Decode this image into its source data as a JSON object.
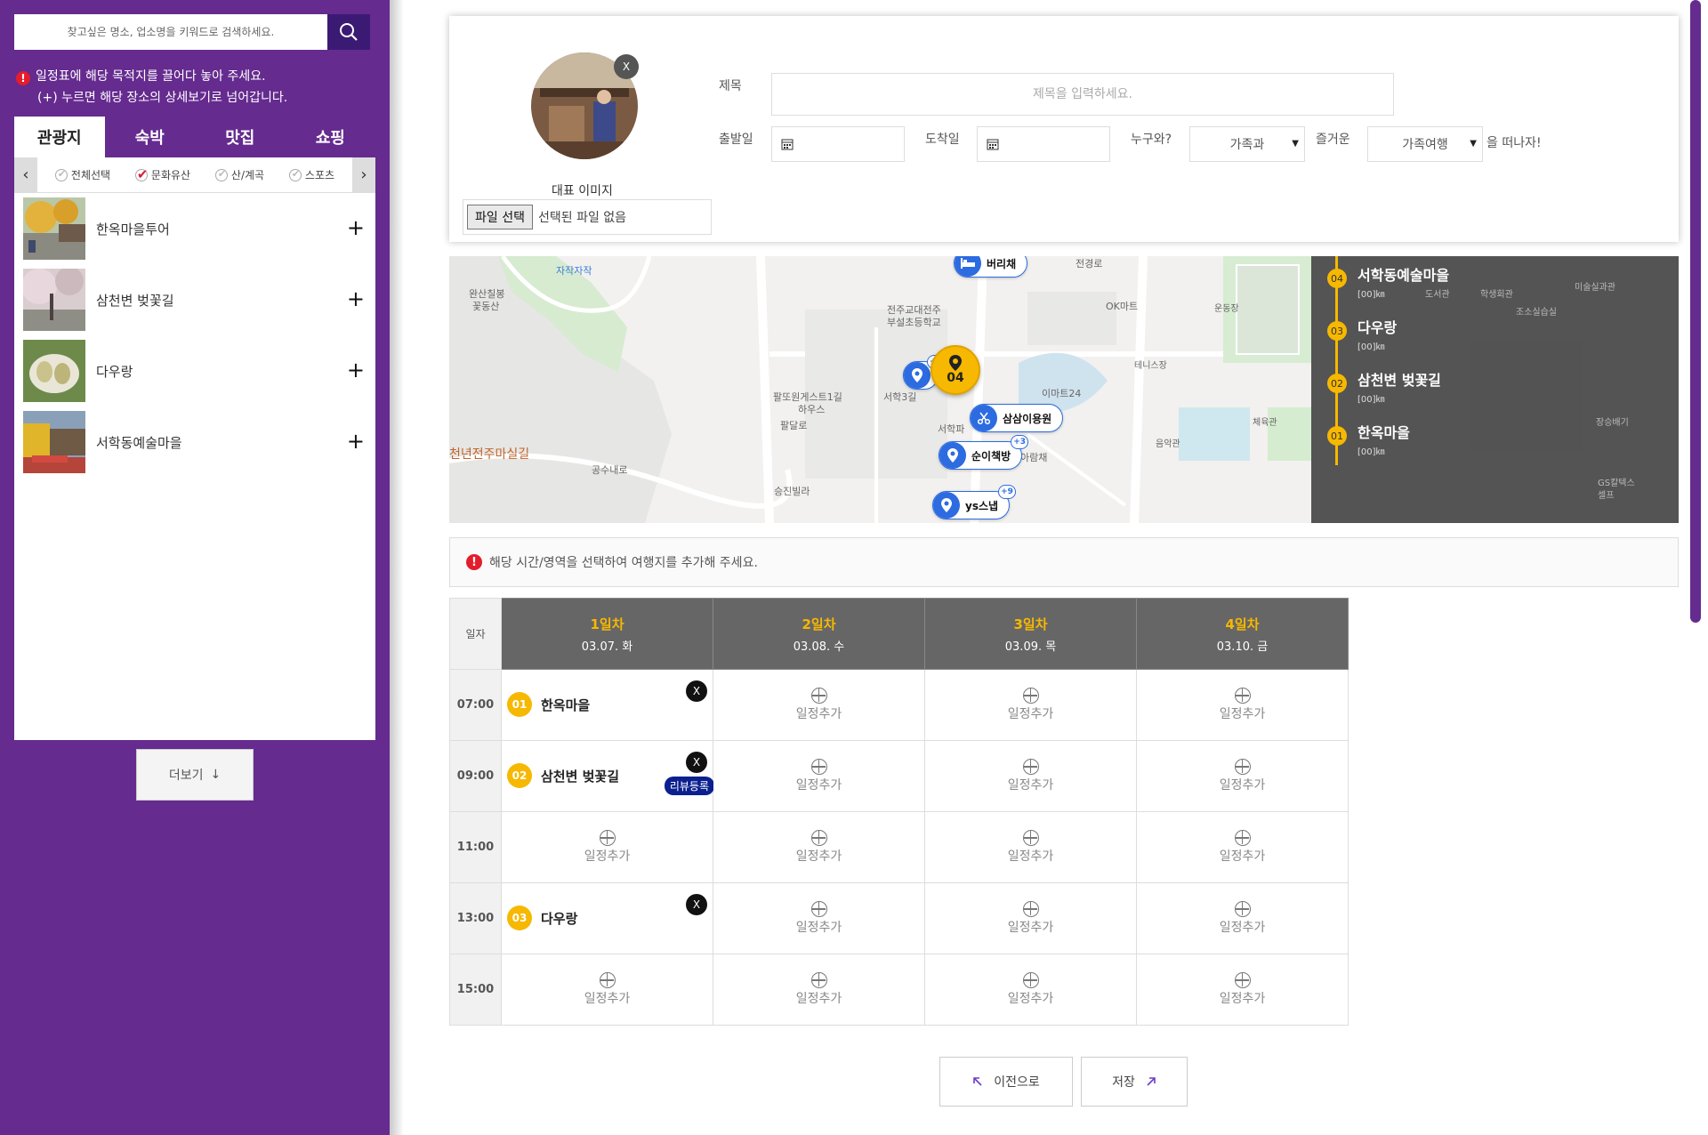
{
  "sidebar": {
    "search_placeholder": "찾고싶은 명소, 업소명을 키워드로 검색하세요.",
    "notice_line1": "일정표에 해당 목적지를 끌어다 놓아 주세요.",
    "notice_line2": "(+) 누르면 해당 장소의 상세보기로 넘어갑니다.",
    "tabs": [
      {
        "label": "관광지"
      },
      {
        "label": "숙박"
      },
      {
        "label": "맛집"
      },
      {
        "label": "쇼핑"
      }
    ],
    "filters": [
      {
        "label": "전체선택",
        "checked": false
      },
      {
        "label": "문화유산",
        "checked": true
      },
      {
        "label": "산/계곡",
        "checked": false
      },
      {
        "label": "스포츠",
        "checked": false
      }
    ],
    "places": [
      {
        "name": "한옥마을투어"
      },
      {
        "name": "삼천변 벚꽃길"
      },
      {
        "name": "다우랑"
      },
      {
        "name": "서학동예술마을"
      }
    ],
    "more_label": "더보기"
  },
  "form": {
    "rep_image_label": "대표 이미지",
    "file_button": "파일 선택",
    "file_status": "선택된 파일 없음",
    "close_label": "X",
    "title_label": "제목",
    "title_placeholder": "제목을 입력하세요.",
    "depart_label": "출발일",
    "arrive_label": "도착일",
    "who_label": "누구와?",
    "who_value": "가족과",
    "fun_label": "즐거운",
    "fun_value": "가족여행",
    "suffix": "을 떠나자!"
  },
  "map": {
    "route": [
      {
        "num": "04",
        "name": "서학동예술마을",
        "dist": "[00]㎞"
      },
      {
        "num": "03",
        "name": "다우랑",
        "dist": "[00]㎞"
      },
      {
        "num": "02",
        "name": "삼천변 벚꽃길",
        "dist": "[00]㎞"
      },
      {
        "num": "01",
        "name": "한옥마을",
        "dist": "[00]㎞"
      }
    ],
    "pins": {
      "p1": "버리채",
      "p2": "삼삼이용원",
      "p3": "순이책방",
      "p4": "ys스냅",
      "badge2": "+2",
      "badge3": "+3",
      "badge4": "+9",
      "big": "04"
    },
    "labels": {
      "l1": "자작자작",
      "l2": "완산칠봉",
      "l3": "꽃동산",
      "l4": "전주교대전주",
      "l5": "부설초등학교",
      "l6": "OK마트",
      "l7": "운동장",
      "l8": "테니스장",
      "l9": "이마트24",
      "l10": "팔또원게스트1길",
      "l11": "하우스",
      "l12": "팔달로",
      "l13": "서학3길",
      "l14": "천년전주마실길",
      "l15": "공수내로",
      "l16": "승진빌라",
      "l17": "체육관",
      "l18": "음악관",
      "l19": "전경로",
      "l20": "학생회관",
      "l21": "미술실과관",
      "l22": "조소실습실",
      "l23": "GS칼텍스",
      "l24": "셀프",
      "l25": "장승배기",
      "l26": "도서관",
      "l27": "서학파",
      "l28": "아람채"
    }
  },
  "instruction": "해당 시간/영역을 선택하여 여행지를 추가해 주세요.",
  "schedule": {
    "corner": "일자",
    "days": [
      {
        "title": "1일차",
        "date": "03.07. 화"
      },
      {
        "title": "2일차",
        "date": "03.08. 수"
      },
      {
        "title": "3일차",
        "date": "03.09. 목"
      },
      {
        "title": "4일차",
        "date": "03.10. 금"
      }
    ],
    "times": [
      "07:00",
      "09:00",
      "11:00",
      "13:00",
      "15:00"
    ],
    "add_label": "일정추가",
    "entries": [
      {
        "num": "01",
        "name": "한옥마을"
      },
      {
        "num": "02",
        "name": "삼천변 벚꽃길",
        "review": "리뷰등록"
      },
      {
        "num": "03",
        "name": "다우랑"
      }
    ],
    "remove_label": "X"
  },
  "buttons": {
    "prev": "이전으로",
    "save": "저장"
  },
  "colors": {
    "sidebar": "#652b8f",
    "accent": "#f6b800",
    "pin": "#2c6be0"
  }
}
